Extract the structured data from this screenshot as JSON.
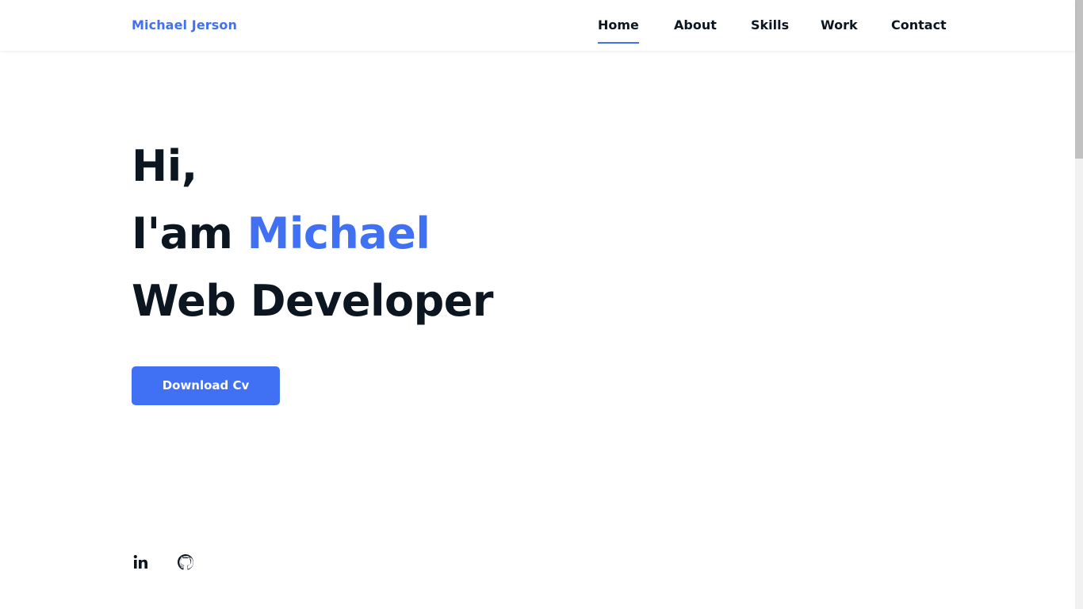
{
  "header": {
    "logo": "Michael Jerson",
    "nav": [
      {
        "label": "Home",
        "active": true
      },
      {
        "label": "About",
        "active": false
      },
      {
        "label": "Skills",
        "active": false
      },
      {
        "label": "Work",
        "active": false
      },
      {
        "label": "Contact",
        "active": false
      }
    ]
  },
  "hero": {
    "greeting": "Hi,",
    "intro_prefix": "I'am ",
    "name": "Michael",
    "role": "Web Developer",
    "cta_label": "Download Cv"
  },
  "social": [
    {
      "icon": "linkedin-icon"
    },
    {
      "icon": "github-icon"
    }
  ],
  "colors": {
    "accent": "#4070f4",
    "text": "#0b1621",
    "background": "#ffffff"
  }
}
